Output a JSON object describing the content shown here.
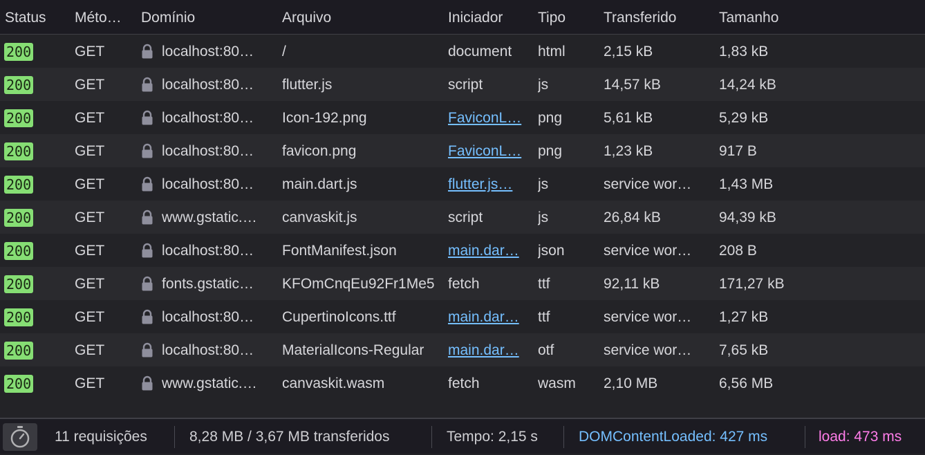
{
  "columns": {
    "status": "Status",
    "method": "Méto…",
    "domain": "Domínio",
    "file": "Arquivo",
    "initiator": "Iniciador",
    "type": "Tipo",
    "transferred": "Transferido",
    "size": "Tamanho"
  },
  "requests": [
    {
      "status": "200",
      "method": "GET",
      "domain": "localhost:80…",
      "file": "/",
      "initiator": "document",
      "initiator_link": false,
      "type": "html",
      "transferred": "2,15 kB",
      "size": "1,83 kB"
    },
    {
      "status": "200",
      "method": "GET",
      "domain": "localhost:80…",
      "file": "flutter.js",
      "initiator": "script",
      "initiator_link": false,
      "type": "js",
      "transferred": "14,57 kB",
      "size": "14,24 kB"
    },
    {
      "status": "200",
      "method": "GET",
      "domain": "localhost:80…",
      "file": "Icon-192.png",
      "initiator": "FaviconL…",
      "initiator_link": true,
      "type": "png",
      "transferred": "5,61 kB",
      "size": "5,29 kB"
    },
    {
      "status": "200",
      "method": "GET",
      "domain": "localhost:80…",
      "file": "favicon.png",
      "initiator": "FaviconL…",
      "initiator_link": true,
      "type": "png",
      "transferred": "1,23 kB",
      "size": "917 B"
    },
    {
      "status": "200",
      "method": "GET",
      "domain": "localhost:80…",
      "file": "main.dart.js",
      "initiator": "flutter.js…",
      "initiator_link": true,
      "type": "js",
      "transferred": "service wor…",
      "size": "1,43 MB"
    },
    {
      "status": "200",
      "method": "GET",
      "domain": "www.gstatic.…",
      "file": "canvaskit.js",
      "initiator": "script",
      "initiator_link": false,
      "type": "js",
      "transferred": "26,84 kB",
      "size": "94,39 kB"
    },
    {
      "status": "200",
      "method": "GET",
      "domain": "localhost:80…",
      "file": "FontManifest.json",
      "initiator": "main.dar…",
      "initiator_link": true,
      "type": "json",
      "transferred": "service wor…",
      "size": "208 B"
    },
    {
      "status": "200",
      "method": "GET",
      "domain": "fonts.gstatic…",
      "file": "KFOmCnqEu92Fr1Me5",
      "initiator": "fetch",
      "initiator_link": false,
      "type": "ttf",
      "transferred": "92,11 kB",
      "size": "171,27 kB"
    },
    {
      "status": "200",
      "method": "GET",
      "domain": "localhost:80…",
      "file": "CupertinoIcons.ttf",
      "initiator": "main.dar…",
      "initiator_link": true,
      "type": "ttf",
      "transferred": "service wor…",
      "size": "1,27 kB"
    },
    {
      "status": "200",
      "method": "GET",
      "domain": "localhost:80…",
      "file": "MaterialIcons-Regular",
      "initiator": "main.dar…",
      "initiator_link": true,
      "type": "otf",
      "transferred": "service wor…",
      "size": "7,65 kB"
    },
    {
      "status": "200",
      "method": "GET",
      "domain": "www.gstatic.…",
      "file": "canvaskit.wasm",
      "initiator": "fetch",
      "initiator_link": false,
      "type": "wasm",
      "transferred": "2,10 MB",
      "size": "6,56 MB"
    }
  ],
  "footer": {
    "requests": "11 requisições",
    "transferred": "8,28 MB / 3,67 MB transferidos",
    "time": "Tempo: 2,15 s",
    "dom_content_loaded": "DOMContentLoaded: 427 ms",
    "load": "load: 473 ms"
  },
  "colors": {
    "status_ok": "#86de74",
    "link": "#75bfff",
    "dom_content_loaded": "#75bfff",
    "load": "#ff7de9"
  },
  "icons": {
    "lock": "lock-icon",
    "timer": "stopwatch-icon"
  }
}
